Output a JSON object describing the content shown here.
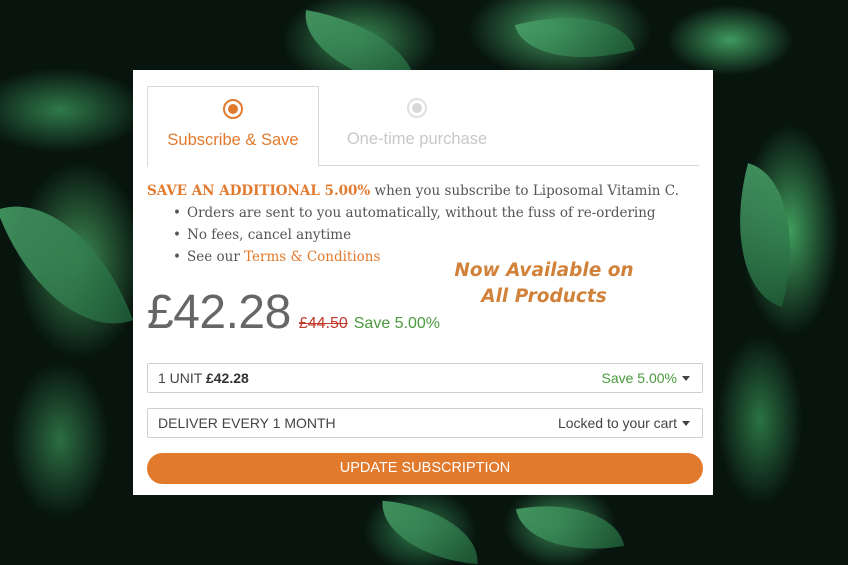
{
  "tabs": {
    "subscribe_label": "Subscribe & Save",
    "onetime_label": "One-time purchase"
  },
  "description": {
    "highlight": "SAVE AN ADDITIONAL 5.00%",
    "text": " when you subscribe to Liposomal Vitamin C.",
    "bullets": [
      "Orders are sent to you automatically, without the fuss of re-ordering",
      "No fees, cancel anytime"
    ],
    "terms_prefix": "See our ",
    "terms_link": "Terms & Conditions"
  },
  "promo": {
    "line1": "Now Available on",
    "line2": "All Products"
  },
  "pricing": {
    "current": "£42.28",
    "original": "£44.50",
    "savings": "Save 5.00%"
  },
  "units_select": {
    "label": "1 UNIT ",
    "amount": "£42.28",
    "savings": "Save 5.00%"
  },
  "delivery_select": {
    "label": "DELIVER EVERY 1 MONTH",
    "value": "Locked to your cart"
  },
  "update_button": {
    "label": "UPDATE SUBSCRIPTION"
  },
  "colors": {
    "accent": "#e27a2e",
    "savings_green": "#4a9a3d",
    "strike_red": "#c0392b"
  }
}
